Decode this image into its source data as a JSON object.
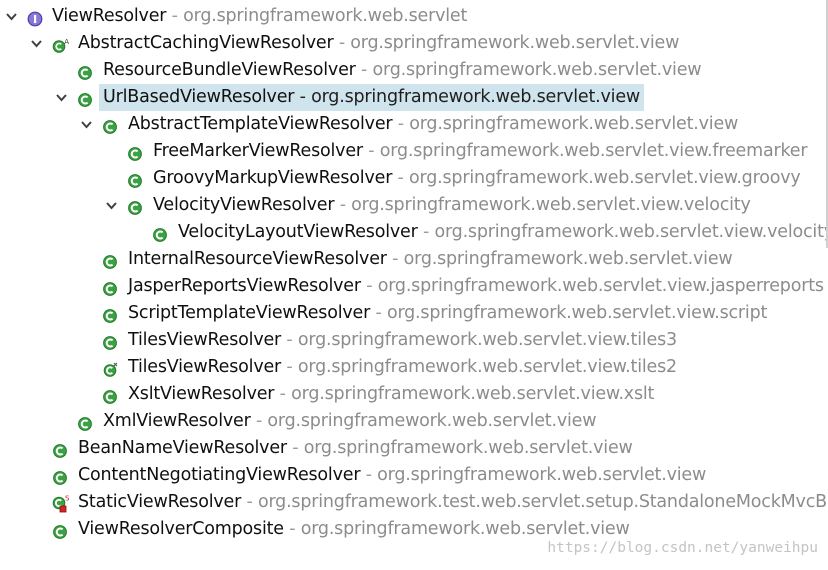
{
  "separator": " - ",
  "tree": [
    {
      "name": "ViewResolver",
      "pkg": "org.springframework.web.servlet",
      "icon": "interface-icon",
      "toggle": "expanded"
    },
    {
      "name": "AbstractCachingViewResolver",
      "pkg": "org.springframework.web.servlet.view",
      "icon": "abstract-class-icon",
      "toggle": "expanded"
    },
    {
      "name": "ResourceBundleViewResolver",
      "pkg": "org.springframework.web.servlet.view",
      "icon": "class-icon",
      "toggle": "none"
    },
    {
      "name": "UrlBasedViewResolver",
      "pkg": "org.springframework.web.servlet.view",
      "icon": "class-icon",
      "toggle": "expanded",
      "selected": true
    },
    {
      "name": "AbstractTemplateViewResolver",
      "pkg": "org.springframework.web.servlet.view",
      "icon": "class-icon",
      "toggle": "expanded"
    },
    {
      "name": "FreeMarkerViewResolver",
      "pkg": "org.springframework.web.servlet.view.freemarker",
      "icon": "class-icon",
      "toggle": "none"
    },
    {
      "name": "GroovyMarkupViewResolver",
      "pkg": "org.springframework.web.servlet.view.groovy",
      "icon": "class-icon",
      "toggle": "none"
    },
    {
      "name": "VelocityViewResolver",
      "pkg": "org.springframework.web.servlet.view.velocity",
      "icon": "class-icon",
      "toggle": "expanded"
    },
    {
      "name": "VelocityLayoutViewResolver",
      "pkg": "org.springframework.web.servlet.view.velocity",
      "icon": "class-icon",
      "toggle": "none"
    },
    {
      "name": "InternalResourceViewResolver",
      "pkg": "org.springframework.web.servlet.view",
      "icon": "class-icon",
      "toggle": "none"
    },
    {
      "name": "JasperReportsViewResolver",
      "pkg": "org.springframework.web.servlet.view.jasperreports",
      "icon": "class-icon",
      "toggle": "none"
    },
    {
      "name": "ScriptTemplateViewResolver",
      "pkg": "org.springframework.web.servlet.view.script",
      "icon": "class-icon",
      "toggle": "none"
    },
    {
      "name": "TilesViewResolver",
      "pkg": "org.springframework.web.servlet.view.tiles3",
      "icon": "class-icon",
      "toggle": "none"
    },
    {
      "name": "TilesViewResolver",
      "pkg": "org.springframework.web.servlet.view.tiles2",
      "icon": "deprecated-class-icon",
      "toggle": "none"
    },
    {
      "name": "XsltViewResolver",
      "pkg": "org.springframework.web.servlet.view.xslt",
      "icon": "class-icon",
      "toggle": "none"
    },
    {
      "name": "XmlViewResolver",
      "pkg": "org.springframework.web.servlet.view",
      "icon": "class-icon",
      "toggle": "none"
    },
    {
      "name": "BeanNameViewResolver",
      "pkg": "org.springframework.web.servlet.view",
      "icon": "class-icon",
      "toggle": "none"
    },
    {
      "name": "ContentNegotiatingViewResolver",
      "pkg": "org.springframework.web.servlet.view",
      "icon": "class-icon",
      "toggle": "none"
    },
    {
      "name": "StaticViewResolver",
      "pkg": "org.springframework.test.web.servlet.setup.StandaloneMockMvcBu",
      "icon": "static-private-class-icon",
      "toggle": "none"
    },
    {
      "name": "ViewResolverComposite",
      "pkg": "org.springframework.web.servlet.view",
      "icon": "class-icon",
      "toggle": "none"
    }
  ],
  "watermark": "https://blog.csdn.net/yanweihpu",
  "colors": {
    "class_icon": "#39a33e",
    "interface_icon": "#6a5acd",
    "selection": "#cfe4ec",
    "package_text": "#8c8c8c"
  }
}
